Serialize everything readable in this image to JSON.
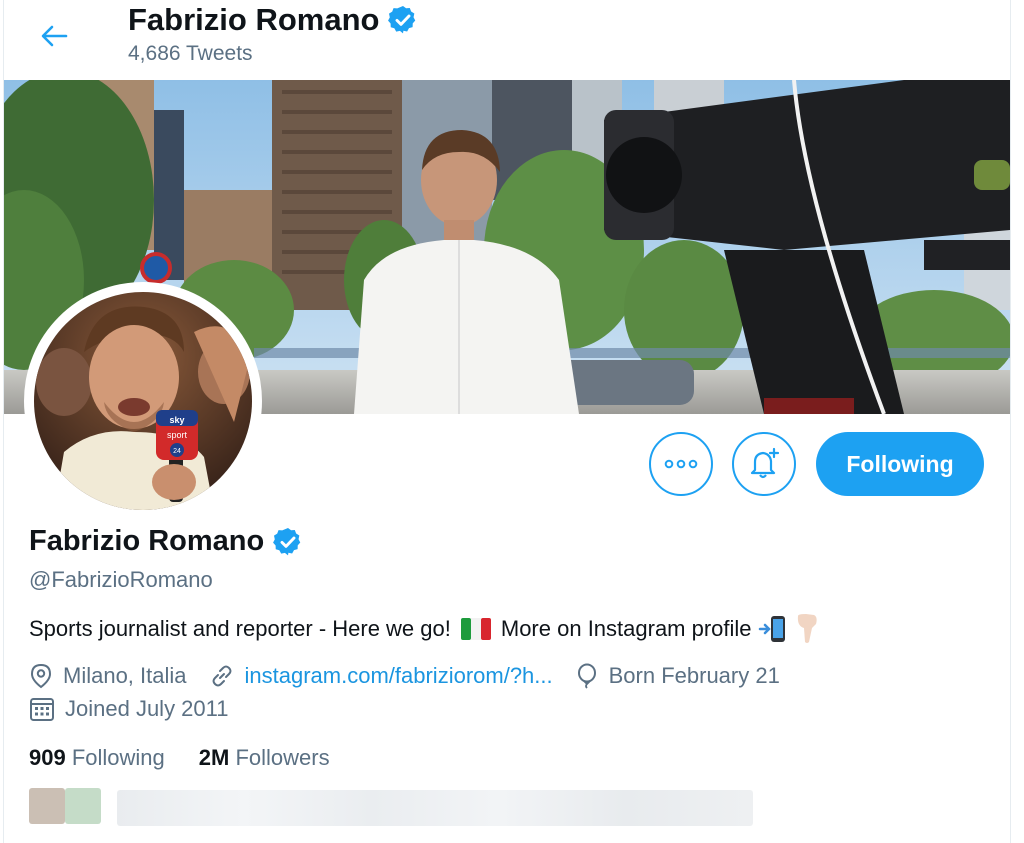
{
  "header": {
    "name": "Fabrizio Romano",
    "tweet_count": "4,686 Tweets"
  },
  "profile": {
    "name": "Fabrizio Romano",
    "handle": "@FabrizioRomano",
    "bio_part1": "Sports journalist and reporter - Here we go!",
    "bio_part2": "More on Instagram profile",
    "location": "Milano, Italia",
    "website": "instagram.com/fabriziorom/?h...",
    "birthday": "Born February 21",
    "joined": "Joined July 2011",
    "following_count": "909",
    "following_label": "Following",
    "followers_count": "2M",
    "followers_label": "Followers",
    "avatar_mic_logo": "sky sport 24"
  },
  "actions": {
    "following_button": "Following"
  },
  "colors": {
    "accent": "#1da1f2",
    "link": "#1b95e0",
    "muted": "#5b7083"
  },
  "icons": {
    "back": "arrow-left-icon",
    "verified": "verified-badge-icon",
    "more": "more-dots-icon",
    "notify": "bell-plus-icon",
    "location": "location-pin-icon",
    "link": "link-icon",
    "birthday": "balloon-icon",
    "calendar": "calendar-icon"
  }
}
